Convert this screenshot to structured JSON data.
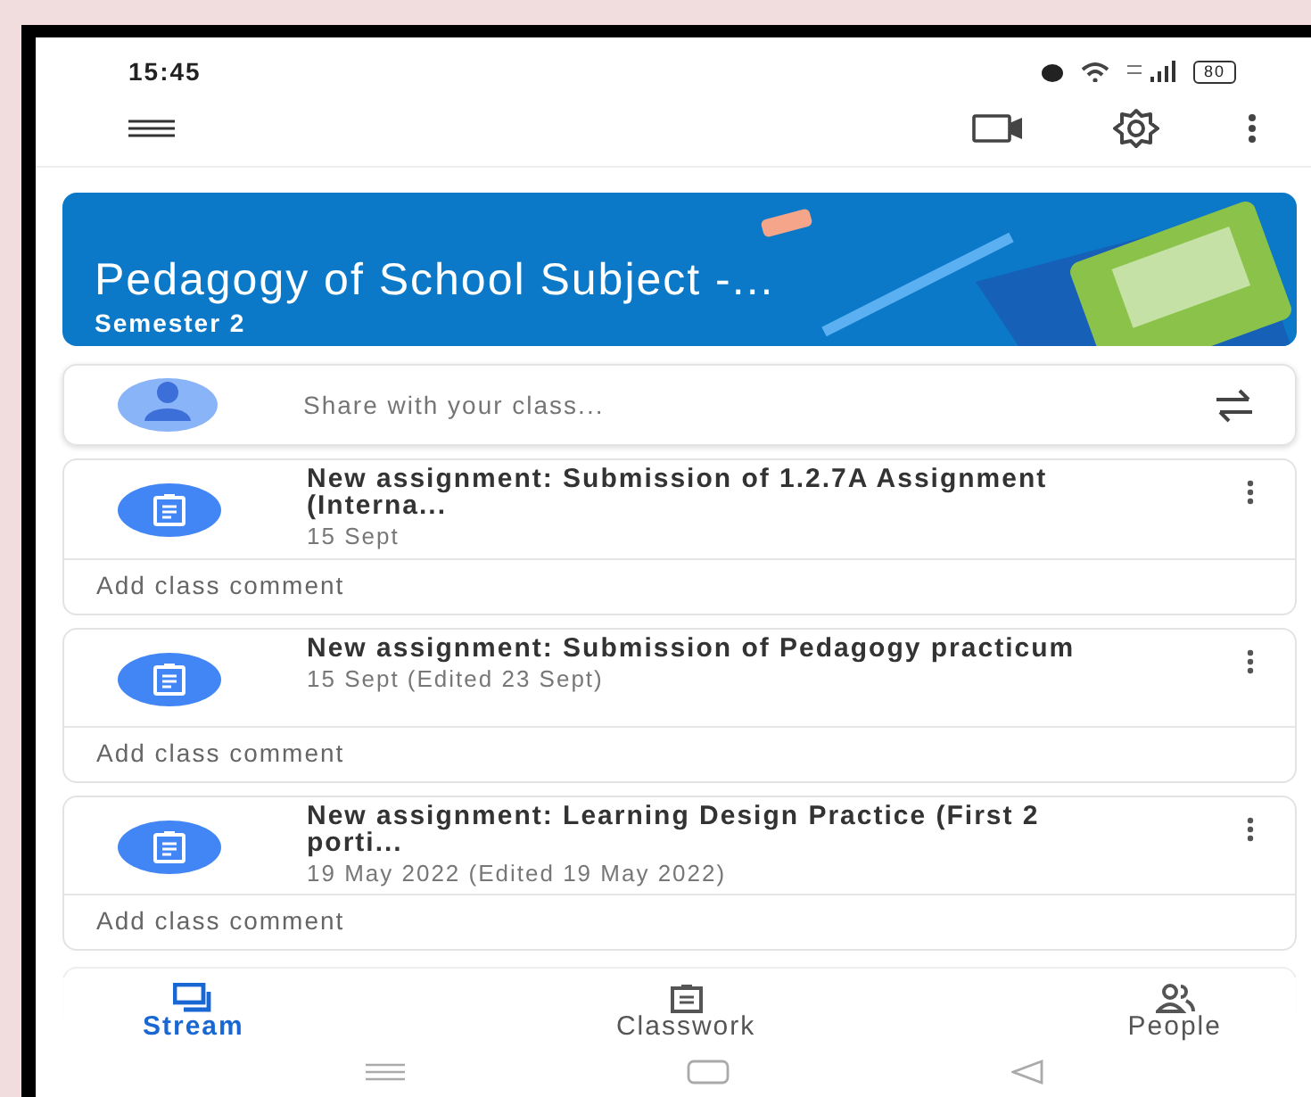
{
  "status_bar": {
    "time": "15:45",
    "battery": "80"
  },
  "course": {
    "title": "Pedagogy of School Subject -...",
    "section": "Semester 2"
  },
  "share": {
    "placeholder": "Share with your class..."
  },
  "posts": [
    {
      "title": "New assignment: Submission of 1.2.7A Assignment (Interna...",
      "date": "15 Sept",
      "comment": "Add class comment"
    },
    {
      "title": "New assignment: Submission of Pedagogy practicum",
      "date": "15 Sept (Edited 23 Sept)",
      "comment": "Add class comment"
    },
    {
      "title": "New assignment: Learning Design Practice (First 2 porti...",
      "date": "19 May 2022 (Edited 19 May 2022)",
      "comment": "Add class comment"
    }
  ],
  "tabs": [
    {
      "label": "Stream",
      "selected": true,
      "kind": "stream"
    },
    {
      "label": "Classwork",
      "selected": false,
      "kind": "classwork"
    },
    {
      "label": "People",
      "selected": false,
      "kind": "people"
    }
  ]
}
